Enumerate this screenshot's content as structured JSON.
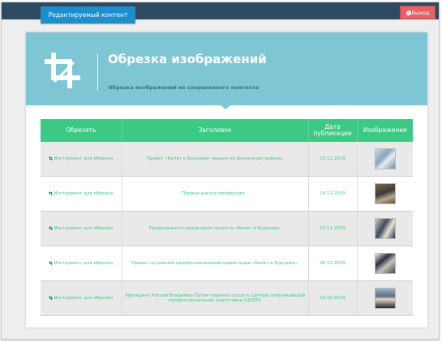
{
  "topbar": {
    "edit_label": "Редактируемый контент",
    "logout_label": "Выход"
  },
  "header": {
    "title": "Обрезка изображений",
    "subtitle": "Обрезка изображений из сохраненного контента"
  },
  "table": {
    "columns": [
      "Обрезать",
      "Заголовок",
      "Дата публикации",
      "Изображение"
    ],
    "rows": [
      {
        "crop": "Инструмент для обрезки",
        "title": "Проект «Билет в будущее» вышел на финишную прямую.",
        "date": "15.11.2019"
      },
      {
        "crop": "Инструмент для обрезки",
        "title": "Первые шаги в профессии...",
        "date": "14.11.2019"
      },
      {
        "crop": "Инструмент для обрезки",
        "title": "Продолжается реализация проекта «Билет в будущее»",
        "date": "10.11.2019"
      },
      {
        "crop": "Инструмент для обрезки",
        "title": "Проект по ранней профессиональной ориентации «Билет в будущее»",
        "date": "06.11.2019"
      },
      {
        "crop": "Инструмент для обрезки",
        "title": "Президент России Владимир Путин поручил создать Центры опережающей профессиональной подготовки (ЦОПП)",
        "date": "20.10.2019"
      }
    ]
  },
  "colors": {
    "topbar": "#2e4a63",
    "edit_tab": "#1d8fcf",
    "header": "#7fc6d5",
    "accent_green": "#3cc985",
    "logout": "#e4636a"
  }
}
